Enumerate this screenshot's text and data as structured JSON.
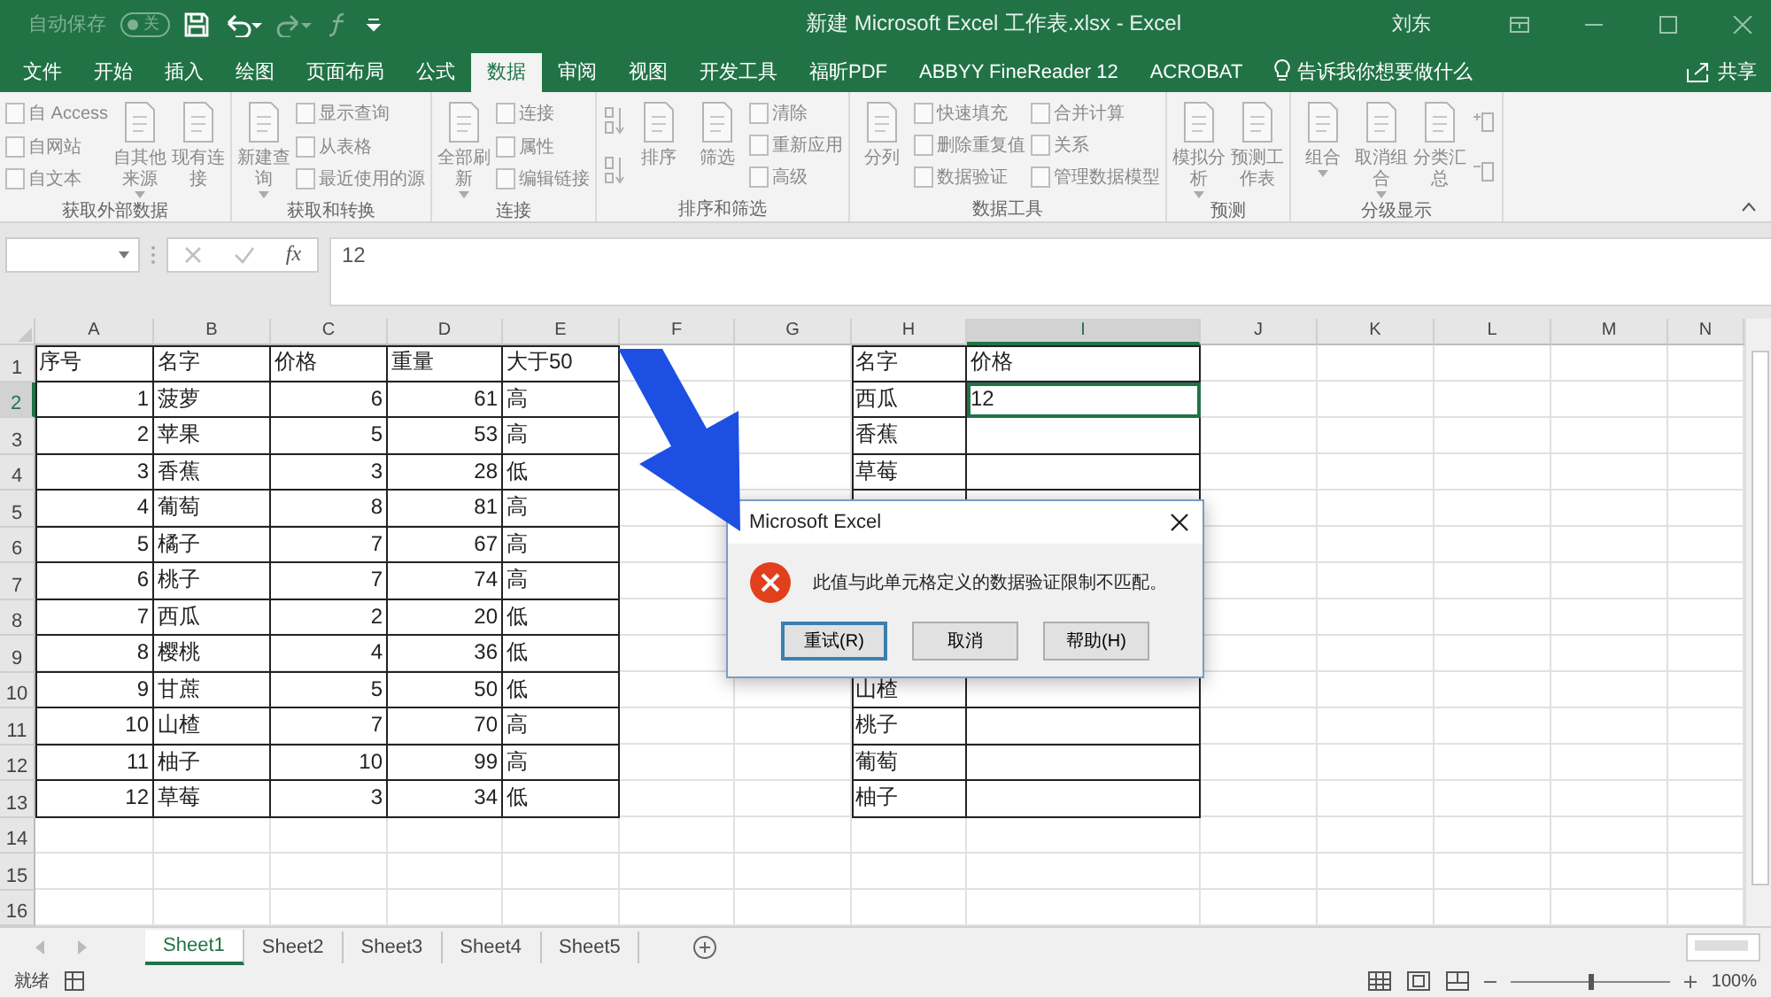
{
  "title_bar": {
    "autosave_label": "自动保存",
    "autosave": {
      "on": false,
      "label": "关"
    },
    "title": "新建 Microsoft Excel 工作表.xlsx  -  Excel",
    "user": "刘东"
  },
  "menu_tabs": [
    {
      "label": "文件",
      "selected": false
    },
    {
      "label": "开始",
      "selected": false
    },
    {
      "label": "插入",
      "selected": false
    },
    {
      "label": "绘图",
      "selected": false
    },
    {
      "label": "页面布局",
      "selected": false
    },
    {
      "label": "公式",
      "selected": false
    },
    {
      "label": "数据",
      "selected": true
    },
    {
      "label": "审阅",
      "selected": false
    },
    {
      "label": "视图",
      "selected": false
    },
    {
      "label": "开发工具",
      "selected": false
    },
    {
      "label": "福昕PDF",
      "selected": false
    },
    {
      "label": "ABBYY FineReader 12",
      "selected": false
    },
    {
      "label": "ACROBAT",
      "selected": false
    }
  ],
  "tell_me": "告诉我你想要做什么",
  "share": "共享",
  "ribbon": {
    "groups": [
      {
        "label": "获取外部数据",
        "columns": [
          {
            "kind": "stack",
            "items": [
              "自 Access",
              "自网站",
              "自文本"
            ]
          },
          {
            "kind": "large",
            "label": "自其他来源",
            "dropdown": true
          },
          {
            "kind": "large",
            "label": "现有连接",
            "dropdown": false
          }
        ]
      },
      {
        "label": "获取和转换",
        "columns": [
          {
            "kind": "large",
            "label": "新建查询",
            "dropdown": true
          },
          {
            "kind": "stack",
            "items": [
              "显示查询",
              "从表格",
              "最近使用的源"
            ]
          }
        ]
      },
      {
        "label": "连接",
        "columns": [
          {
            "kind": "large",
            "label": "全部刷新",
            "dropdown": true
          },
          {
            "kind": "stack",
            "items": [
              "连接",
              "属性",
              "编辑链接"
            ]
          }
        ]
      },
      {
        "label": "排序和筛选",
        "columns": [
          {
            "kind": "sort"
          },
          {
            "kind": "large",
            "label": "排序",
            "dropdown": false
          },
          {
            "kind": "large",
            "label": "筛选",
            "dropdown": false
          },
          {
            "kind": "stack",
            "items": [
              "清除",
              "重新应用",
              "高级"
            ]
          }
        ]
      },
      {
        "label": "数据工具",
        "columns": [
          {
            "kind": "large",
            "label": "分列",
            "dropdown": false
          },
          {
            "kind": "stack",
            "items": [
              "快速填充",
              "删除重复值",
              "数据验证"
            ]
          },
          {
            "kind": "stack",
            "items": [
              "合并计算",
              "关系",
              "管理数据模型"
            ]
          }
        ]
      },
      {
        "label": "预测",
        "columns": [
          {
            "kind": "large",
            "label": "模拟分析",
            "dropdown": true
          },
          {
            "kind": "large",
            "label": "预测工作表",
            "dropdown": false
          }
        ]
      },
      {
        "label": "分级显示",
        "columns": [
          {
            "kind": "large",
            "label": "组合",
            "dropdown": true
          },
          {
            "kind": "large",
            "label": "取消组合",
            "dropdown": true
          },
          {
            "kind": "large",
            "label": "分类汇总",
            "dropdown": false
          },
          {
            "kind": "outline"
          }
        ]
      }
    ]
  },
  "formula_bar": {
    "fx": "fx",
    "value": "12"
  },
  "sheet": {
    "columns": [
      {
        "label": "A",
        "selected": false
      },
      {
        "label": "B",
        "selected": false
      },
      {
        "label": "C",
        "selected": false
      },
      {
        "label": "D",
        "selected": false
      },
      {
        "label": "E",
        "selected": false
      },
      {
        "label": "F",
        "selected": false
      },
      {
        "label": "G",
        "selected": false
      },
      {
        "label": "H",
        "selected": false
      },
      {
        "label": "I",
        "selected": true
      },
      {
        "label": "J",
        "selected": false
      },
      {
        "label": "K",
        "selected": false
      },
      {
        "label": "L",
        "selected": false
      },
      {
        "label": "M",
        "selected": false
      },
      {
        "label": "N",
        "selected": false
      }
    ],
    "rows": [
      {
        "label": "1",
        "selected": false
      },
      {
        "label": "2",
        "selected": true
      },
      {
        "label": "3",
        "selected": false
      },
      {
        "label": "4",
        "selected": false
      },
      {
        "label": "5",
        "selected": false
      },
      {
        "label": "6",
        "selected": false
      },
      {
        "label": "7",
        "selected": false
      },
      {
        "label": "8",
        "selected": false
      },
      {
        "label": "9",
        "selected": false
      },
      {
        "label": "10",
        "selected": false
      },
      {
        "label": "11",
        "selected": false
      },
      {
        "label": "12",
        "selected": false
      },
      {
        "label": "13",
        "selected": false
      },
      {
        "label": "14",
        "selected": false
      },
      {
        "label": "15",
        "selected": false
      },
      {
        "label": "16",
        "selected": false
      }
    ]
  },
  "left_table": {
    "rows": [
      [
        "序号",
        "名字",
        "价格",
        "重量",
        "大于50"
      ],
      [
        "1",
        "菠萝",
        "6",
        "61",
        "高"
      ],
      [
        "2",
        "苹果",
        "5",
        "53",
        "高"
      ],
      [
        "3",
        "香蕉",
        "3",
        "28",
        "低"
      ],
      [
        "4",
        "葡萄",
        "8",
        "81",
        "高"
      ],
      [
        "5",
        "橘子",
        "7",
        "67",
        "高"
      ],
      [
        "6",
        "桃子",
        "7",
        "74",
        "高"
      ],
      [
        "7",
        "西瓜",
        "2",
        "20",
        "低"
      ],
      [
        "8",
        "樱桃",
        "4",
        "36",
        "低"
      ],
      [
        "9",
        "甘蔗",
        "5",
        "50",
        "低"
      ],
      [
        "10",
        "山楂",
        "7",
        "70",
        "高"
      ],
      [
        "11",
        "柚子",
        "10",
        "99",
        "高"
      ],
      [
        "12",
        "草莓",
        "3",
        "34",
        "低"
      ]
    ]
  },
  "right_table": {
    "rows_top": [
      {
        "name": "名字",
        "value": "价格",
        "selected": false
      },
      {
        "name": "西瓜",
        "value": "12",
        "selected": true
      },
      {
        "name": "香蕉",
        "selected": false
      },
      {
        "name": "草莓",
        "selected": false
      }
    ],
    "rows_bottom": [
      {
        "name": "山楂",
        "selected": false
      },
      {
        "name": "桃子",
        "selected": false
      },
      {
        "name": "葡萄",
        "selected": false
      },
      {
        "name": "柚子",
        "selected": false
      }
    ]
  },
  "dialog": {
    "title": "Microsoft Excel",
    "message": "此值与此单元格定义的数据验证限制不匹配。",
    "buttons": [
      {
        "label": "重试(R)",
        "selected": true
      },
      {
        "label": "取消",
        "selected": false
      },
      {
        "label": "帮助(H)",
        "selected": false
      }
    ]
  },
  "sheet_tabs": [
    {
      "label": "Sheet1",
      "selected": true
    },
    {
      "label": "Sheet2",
      "selected": false
    },
    {
      "label": "Sheet3",
      "selected": false
    },
    {
      "label": "Sheet4",
      "selected": false
    },
    {
      "label": "Sheet5",
      "selected": false
    }
  ],
  "status_bar": {
    "status": "就绪",
    "zoom": {
      "level": 0.5,
      "reading": "100%"
    }
  }
}
